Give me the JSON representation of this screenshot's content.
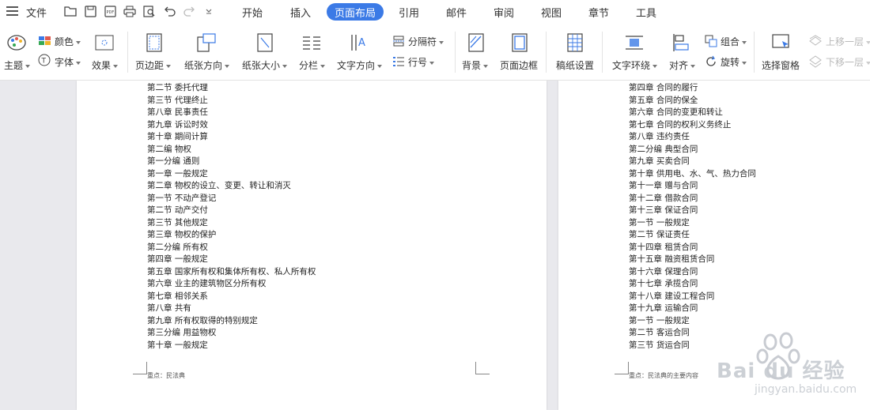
{
  "menu": {
    "file_label": "文件",
    "tabs": [
      "开始",
      "插入",
      "页面布局",
      "引用",
      "邮件",
      "审阅",
      "视图",
      "章节",
      "工具"
    ],
    "active_tab": "页面布局",
    "accent": "#3b7ae6"
  },
  "ribbon": {
    "theme": "主题",
    "color": "颜色",
    "font": "字体",
    "effect": "效果",
    "margin": "页边距",
    "orientation": "纸张方向",
    "size": "纸张大小",
    "columns": "分栏",
    "text_direction": "文字方向",
    "separator": "分隔符",
    "line_number": "行号",
    "background": "背景",
    "page_border": "页面边框",
    "draft_setup": "稿纸设置",
    "wrap_text": "文字环绕",
    "align": "对齐",
    "group": "组合",
    "rotate": "旋转",
    "select_pane": "选择窗格",
    "bring_forward": "上移一层",
    "send_backward": "下移一层"
  },
  "page1": {
    "lines": [
      "第二节 委托代理",
      "第三节 代理终止",
      "第八章 民事责任",
      "第九章 诉讼时效",
      "第十章 期间计算",
      "第二编 物权",
      "第一分编 通则",
      "第一章 一般规定",
      "第二章 物权的设立、变更、转让和消灭",
      "第一节 不动产登记",
      "第二节 动产交付",
      "第三节 其他规定",
      "第三章 物权的保护",
      "第二分编 所有权",
      "第四章 一般规定",
      "第五章 国家所有权和集体所有权、私人所有权",
      "第六章 业主的建筑物区分所有权",
      "第七章 相邻关系",
      "第八章 共有",
      "第九章 所有权取得的特别规定",
      "第三分编 用益物权",
      "第十章 一般规定"
    ],
    "footer": "重点：民法典"
  },
  "page2": {
    "lines": [
      "第四章 合同的履行",
      "第五章 合同的保全",
      "第六章 合同的变更和转让",
      "第七章 合同的权利义务终止",
      "第八章 违约责任",
      "第二分编 典型合同",
      "第九章 买卖合同",
      "第十章 供用电、水、气、热力合同",
      "第十一章 赠与合同",
      "第十二章 借款合同",
      "第十三章 保证合同",
      "第一节 一般规定",
      "第二节 保证责任",
      "第十四章 租赁合同",
      "第十五章 融资租赁合同",
      "第十六章 保理合同",
      "第十七章 承揽合同",
      "第十八章 建设工程合同",
      "第十九章 运输合同",
      "第一节 一般规定",
      "第二节 客运合同",
      "第三节 货运合同"
    ],
    "footer": "重点：民法典的主要内容"
  },
  "watermark": {
    "brand": "Bai du 经验",
    "url": "jingyan.baidu.com"
  }
}
